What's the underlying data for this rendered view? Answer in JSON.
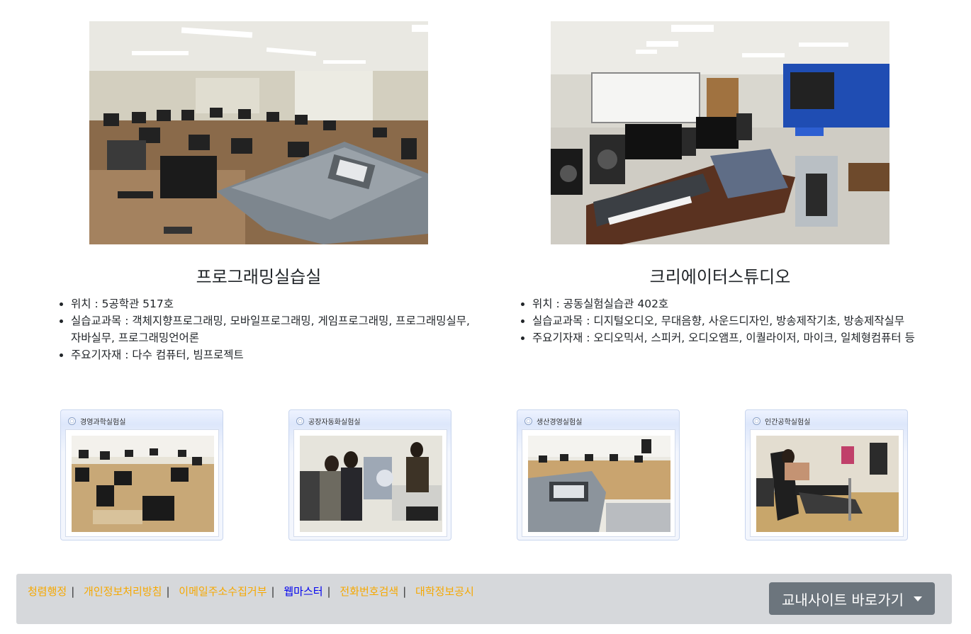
{
  "labs": [
    {
      "title": "프로그래밍실습실",
      "details": [
        "위치 : 5공학관 517호",
        "실습교과목 : 객체지향프로그래밍, 모바일프로그래밍, 게임프로그래밍, 프로그래밍실무, 자바실무, 프로그래밍언어론",
        "주요기자재 : 다수 컴퓨터, 빔프로젝트"
      ]
    },
    {
      "title": "크리에이터스튜디오",
      "details": [
        "위치 : 공동실험실습관 402호",
        "실습교과목 : 디지털오디오, 무대음향, 사운드디자인, 방송제작기초, 방송제작실무",
        "주요기자재 : 오디오믹서, 스피커, 오디오앰프, 이퀄라이저, 마이크, 일체형컴퓨터 등"
      ]
    }
  ],
  "thumbnails": [
    {
      "caption": "경영과학실험실"
    },
    {
      "caption": "공장자동화실험실"
    },
    {
      "caption": "생산경영실험실"
    },
    {
      "caption": "인간공학실험실"
    }
  ],
  "footer": {
    "links": [
      {
        "label": "청렴행정",
        "color": "orange"
      },
      {
        "label": "개인정보처리방침",
        "color": "orange"
      },
      {
        "label": "이메일주소수집거부",
        "color": "orange"
      },
      {
        "label": "웹마스터",
        "color": "blue"
      },
      {
        "label": "전화번호검색",
        "color": "orange"
      },
      {
        "label": "대학정보공시",
        "color": "orange"
      }
    ],
    "separator": "|",
    "dropdown_label": "교내사이트 바로가기"
  },
  "colors": {
    "link_orange": "#f6a800",
    "link_blue": "#0000ee",
    "footer_bg": "#d6d8db",
    "button_bg": "#6c757d"
  }
}
